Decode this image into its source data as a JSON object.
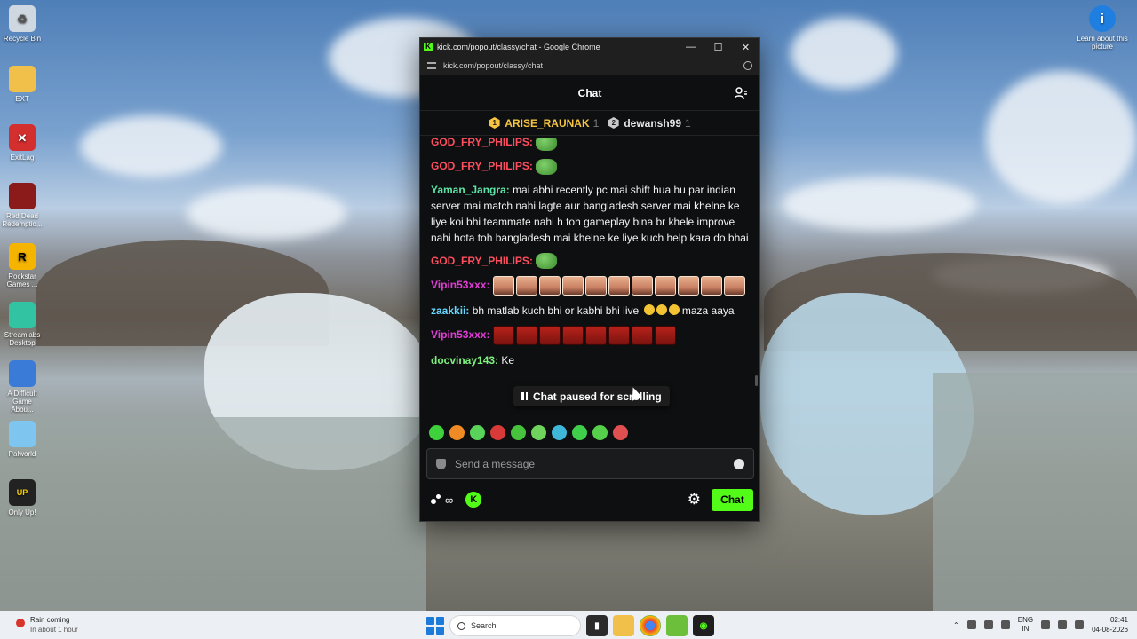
{
  "desktop": {
    "icons": [
      {
        "label": "Recycle Bin",
        "icon": "recycle-bin-icon",
        "color": "#cfd8e0"
      },
      {
        "label": "EXT",
        "icon": "folder-icon",
        "color": "#f1c04a"
      },
      {
        "label": "ExitLag",
        "icon": "exitlag-icon",
        "color": "#d32f2f"
      },
      {
        "label": "Red Dead Redemptio...",
        "icon": "rdr-icon",
        "color": "#8b1a1a"
      },
      {
        "label": "Rockstar Games ...",
        "icon": "rockstar-icon",
        "color": "#f5b400"
      },
      {
        "label": "Streamlabs Desktop",
        "icon": "streamlabs-icon",
        "color": "#31c3a2"
      },
      {
        "label": "A Difficult Game Abou...",
        "icon": "game-icon",
        "color": "#3b7bd8"
      },
      {
        "label": "Palworld",
        "icon": "palworld-icon",
        "color": "#7ec6ef"
      },
      {
        "label": "Only Up!",
        "icon": "onlyup-icon",
        "color": "#222222"
      }
    ],
    "right_icon": {
      "label": "Learn about this picture",
      "icon": "info-icon"
    }
  },
  "window": {
    "title": "kick.com/popout/classy/chat - Google Chrome",
    "url": "kick.com/popout/classy/chat"
  },
  "chat": {
    "header": "Chat",
    "leaders": [
      {
        "rank": "1",
        "name": "ARISE_RAUNAK",
        "count": "1",
        "color": "#f5c542",
        "badge_color": "#f5c542"
      },
      {
        "rank": "2",
        "name": "dewansh99",
        "count": "1",
        "color": "#e6e6e6",
        "badge_color": "#c9c9c9"
      }
    ],
    "messages": [
      {
        "user": "GOD_FRY_PHILIPS",
        "user_color": "#ff4d5e",
        "text": "",
        "emotes": "frog",
        "emote_count": 1
      },
      {
        "user": "GOD_FRY_PHILIPS",
        "user_color": "#ff4d5e",
        "text": "",
        "emotes": "frog",
        "emote_count": 1
      },
      {
        "user": "Yaman_Jangra",
        "user_color": "#5fe4a8",
        "text": "mai abhi recently pc mai shift hua hu par indian server mai match nahi lagte aur bangladesh server mai khelne ke liye koi bhi teammate nahi h toh gameplay bina br khele improve nahi hota toh bangladesh mai khelne ke liye kuch help kara do bhai",
        "emotes": "",
        "emote_count": 0
      },
      {
        "user": "GOD_FRY_PHILIPS",
        "user_color": "#ff4d5e",
        "text": "",
        "emotes": "frog",
        "emote_count": 1
      },
      {
        "user": "Vipin53xxx",
        "user_color": "#e23cd6",
        "text": "",
        "emotes": "face",
        "emote_count": 11
      },
      {
        "user": "zaakkii",
        "user_color": "#68d9ff",
        "text": "bh matlab kuch bhi or kabhi bhi live",
        "text_after": "maza aaya",
        "emotes": "lol",
        "emote_count": 3
      },
      {
        "user": "Vipin53xxx",
        "user_color": "#e23cd6",
        "text": "",
        "emotes": "red",
        "emote_count": 8
      },
      {
        "user": "docvinay143",
        "user_color": "#7ef07e",
        "text": "Ke",
        "emotes": "",
        "emote_count": 0
      }
    ],
    "paused_label": "Chat paused for scrolling",
    "emote_bar_colors": [
      "#3fd13b",
      "#f08a24",
      "#5ad35a",
      "#d83a3a",
      "#47c23d",
      "#6fd45b",
      "#3fb7d9",
      "#3fcf4a",
      "#56d04a",
      "#e05050"
    ],
    "input_placeholder": "Send a message",
    "points_label": "∞",
    "k_badge": "K",
    "send_label": "Chat",
    "accent": "#53fc18"
  },
  "taskbar": {
    "weather_title": "Rain coming",
    "weather_sub": "In about 1 hour",
    "search_label": "Search",
    "lang_top": "ENG",
    "lang_bottom": "IN",
    "time": "02:41",
    "date": "04-08-2026"
  }
}
